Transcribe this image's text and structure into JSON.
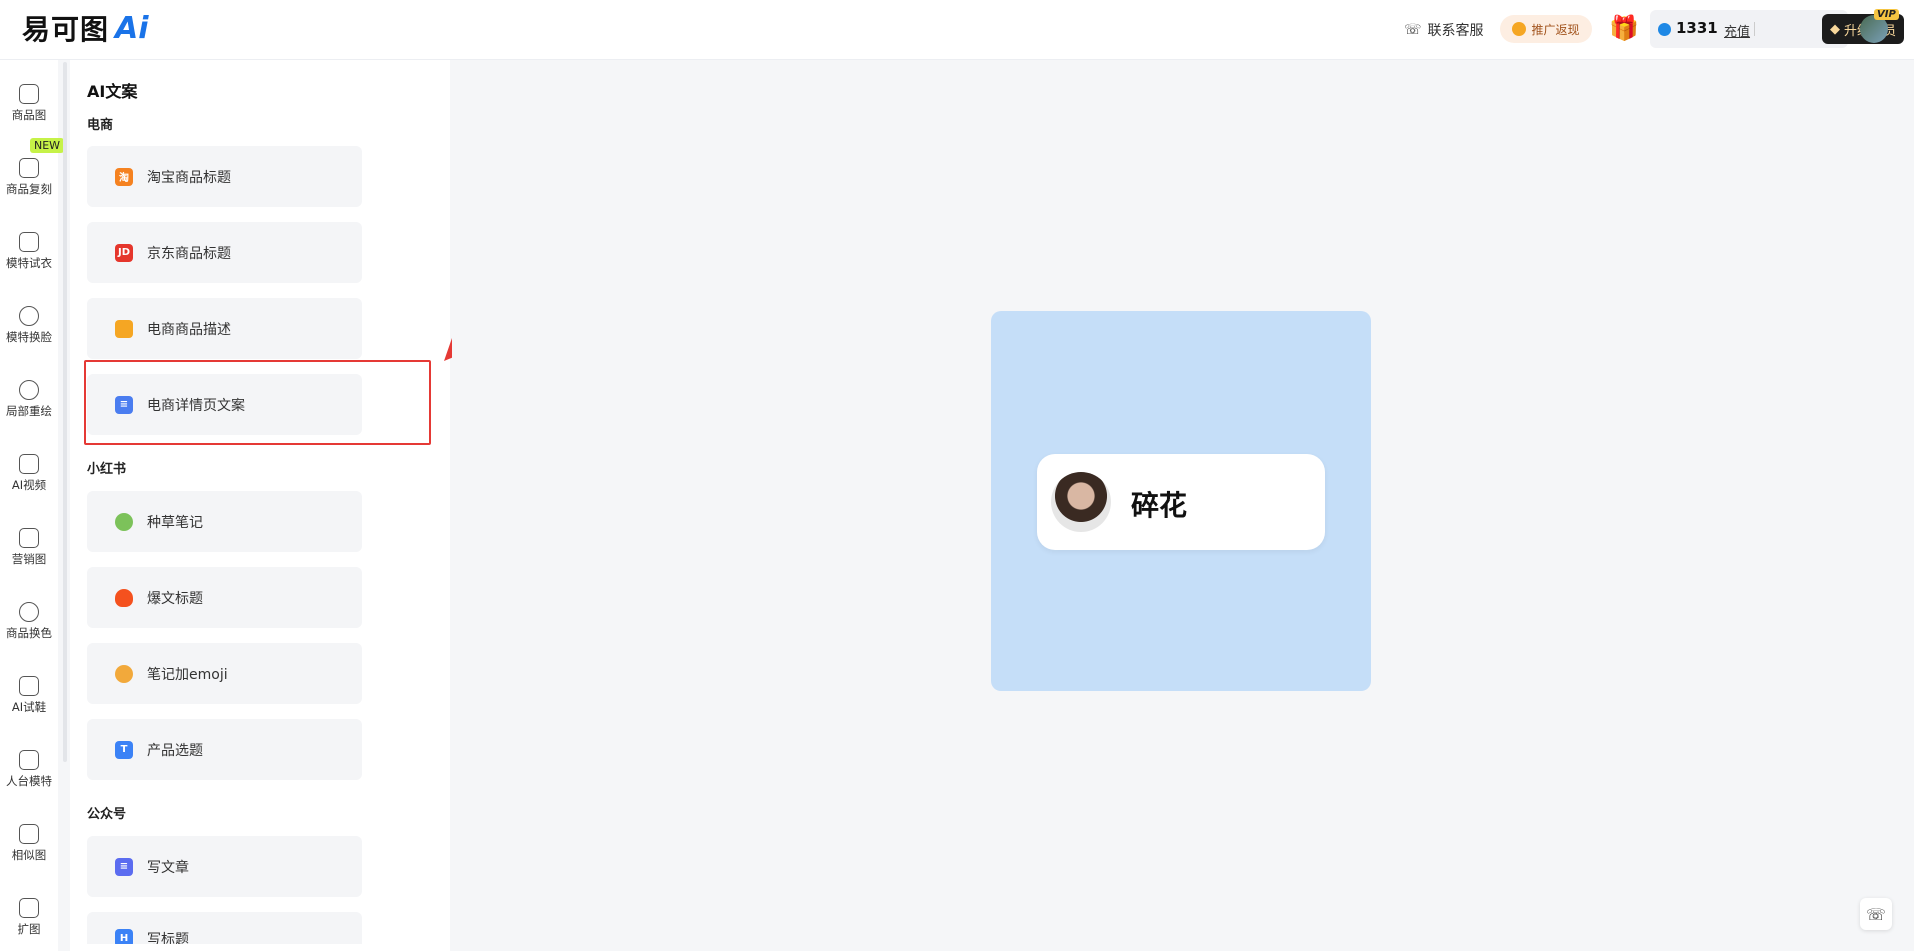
{
  "header": {
    "logo_text": "易可图",
    "logo_ai": "Ai",
    "service_label": "联系客服",
    "promo_label": "推广返现",
    "credits": "1331",
    "recharge_label": "充值",
    "upgrade_label": "升级会员",
    "vip_tag": "VIP"
  },
  "nav": [
    {
      "label": "商品图",
      "icon": "bag-icon"
    },
    {
      "label": "商品复刻",
      "icon": "bag-icon",
      "badge": "NEW"
    },
    {
      "label": "模特试衣",
      "icon": "shirt-icon"
    },
    {
      "label": "模特换脸",
      "icon": "face-icon"
    },
    {
      "label": "局部重绘",
      "icon": "face-icon"
    },
    {
      "label": "AI视频",
      "icon": "video-icon"
    },
    {
      "label": "营销图",
      "icon": "doc-icon"
    },
    {
      "label": "商品换色",
      "icon": "drop-icon"
    },
    {
      "label": "AI试鞋",
      "icon": "shoe-icon"
    },
    {
      "label": "人台模特",
      "icon": "mannequin-icon"
    },
    {
      "label": "相似图",
      "icon": "image-icon"
    },
    {
      "label": "扩图",
      "icon": "expand-icon"
    }
  ],
  "new_badge": "NEW",
  "panel": {
    "title": "AI文案",
    "sections": [
      {
        "title": "电商"
      },
      {
        "title": "小红书"
      },
      {
        "title": "公众号"
      }
    ],
    "tools": [
      {
        "label": "淘宝商品标题",
        "icon": "taobao-icon",
        "color": "#f58220",
        "glyph": "淘"
      },
      {
        "label": "京东商品标题",
        "icon": "jd-icon",
        "color": "#e5362c",
        "glyph": "JD"
      },
      {
        "label": "电商商品描述",
        "icon": "shopping-bag-icon",
        "color": "#f5a623",
        "glyph": ""
      },
      {
        "label": "电商详情页文案",
        "icon": "document-icon",
        "color": "#4a7df0",
        "glyph": "≡"
      },
      {
        "label": "种草笔记",
        "icon": "sprout-icon",
        "color": "#7cc25a",
        "glyph": ""
      },
      {
        "label": "爆文标题",
        "icon": "fire-icon",
        "color": "#f4511e",
        "glyph": ""
      },
      {
        "label": "笔记加emoji",
        "icon": "emoji-icon",
        "color": "#f2a93b",
        "glyph": ""
      },
      {
        "label": "产品选题",
        "icon": "t-icon",
        "color": "#3b82f6",
        "glyph": "T"
      },
      {
        "label": "写文章",
        "icon": "article-icon",
        "color": "#5b6cf0",
        "glyph": "≡"
      },
      {
        "label": "写标题",
        "icon": "h-icon",
        "color": "#3b82f6",
        "glyph": "H"
      }
    ]
  },
  "preview": {
    "name": "碎花"
  }
}
